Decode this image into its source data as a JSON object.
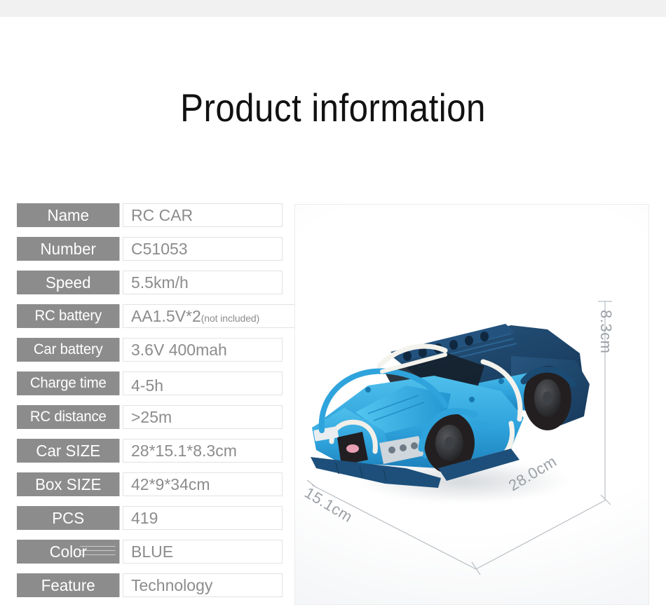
{
  "page": {
    "title": "Product information"
  },
  "spec_table": {
    "rows": [
      {
        "label": "Name",
        "value": "RC CAR",
        "note": ""
      },
      {
        "label": "Number",
        "value": "C51053",
        "note": ""
      },
      {
        "label": "Speed",
        "value": "5.5km/h",
        "note": ""
      },
      {
        "label": "RC battery",
        "value": "AA1.5V*2",
        "note": "(not included)"
      },
      {
        "label": "Car battery",
        "value": "3.6V 400mah",
        "note": ""
      },
      {
        "label": "Charge time",
        "value": "4-5h",
        "note": ""
      },
      {
        "label": "RC distance",
        "value": ">25m",
        "note": ""
      },
      {
        "label": "Car SIZE",
        "value": "28*15.1*8.3cm",
        "note": ""
      },
      {
        "label": "Box SIZE",
        "value": "42*9*34cm",
        "note": ""
      },
      {
        "label": "PCS",
        "value": "419",
        "note": ""
      },
      {
        "label": "Color",
        "value": "BLUE",
        "note": ""
      },
      {
        "label": "Feature",
        "value": "Technology",
        "note": ""
      }
    ]
  },
  "product_image": {
    "alt": "blue technic building-block sports car",
    "dimensions": {
      "height": "8.3cm",
      "width": "28.0cm",
      "depth": "15.1cm"
    }
  },
  "colors": {
    "label_background": "#8c8c8c",
    "label_text": "#ffffff",
    "value_text": "#8c8c8c",
    "value_border": "#e2e2e2",
    "title_text": "#111111",
    "top_band": "#f1f1f1",
    "dimension_line": "#b9bec4",
    "car_light_blue": "#35a8dd",
    "car_mid_blue": "#1f7fba",
    "car_dark_blue": "#1b4a72",
    "car_tire": "#231f20"
  }
}
